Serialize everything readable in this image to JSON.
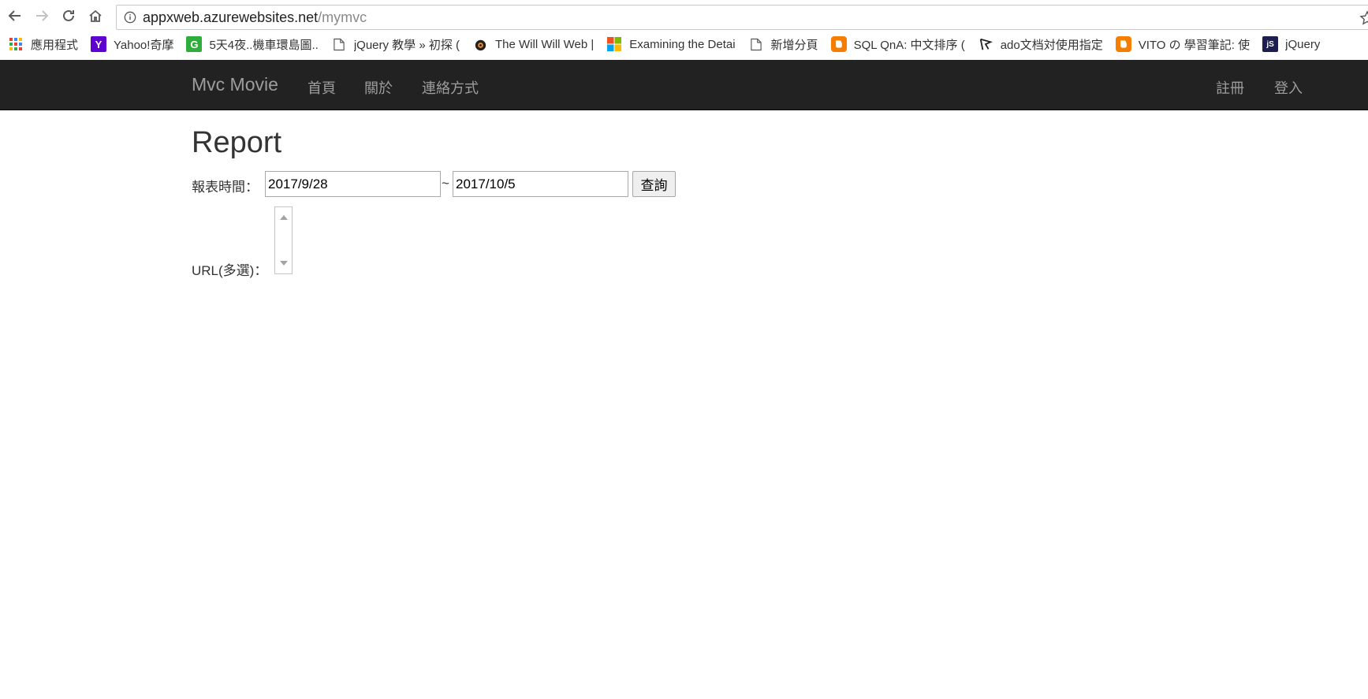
{
  "browser": {
    "url_host": "appxweb.azurewebsites.net",
    "url_path": "/mymvc",
    "bookmarks": [
      {
        "label": "應用程式",
        "icon": "apps-grid-icon"
      },
      {
        "label": "Yahoo!奇摩",
        "icon": "yahoo-icon",
        "icon_text": "Y",
        "color": "#5f01d1"
      },
      {
        "label": "5天4夜..機車環島圖..",
        "icon": "site-icon",
        "icon_text": "G",
        "color": "#2fae3c"
      },
      {
        "label": "jQuery 教學 » 初探 (",
        "icon": "page-icon"
      },
      {
        "label": "The Will Will Web |",
        "icon": "eye-icon"
      },
      {
        "label": "Examining the Detai",
        "icon": "microsoft-icon"
      },
      {
        "label": "新增分頁",
        "icon": "page-icon"
      },
      {
        "label": "SQL QnA: 中文排序 (",
        "icon": "blogger-icon",
        "color": "#f57d00"
      },
      {
        "label": "ado文档対使用指定",
        "icon": "flag-icon"
      },
      {
        "label": "VITO の 學習筆記: 使",
        "icon": "blogger-icon",
        "color": "#f57d00"
      },
      {
        "label": "jQuery",
        "icon": "site-icon",
        "icon_text": "jS",
        "color": "#1d1d50"
      }
    ]
  },
  "navbar": {
    "brand": "Mvc Movie",
    "links": [
      "首頁",
      "關於",
      "連絡方式"
    ],
    "register": "註冊",
    "login": "登入"
  },
  "page": {
    "title": "Report",
    "report_time_label": "報表時間：",
    "start_date": "2017/9/28",
    "separator": "~",
    "end_date": "2017/10/5",
    "query_button": "查詢",
    "url_label": "URL(多選)："
  },
  "colors": {
    "navbar_bg": "#222222",
    "navbar_text": "#9d9d9d"
  }
}
